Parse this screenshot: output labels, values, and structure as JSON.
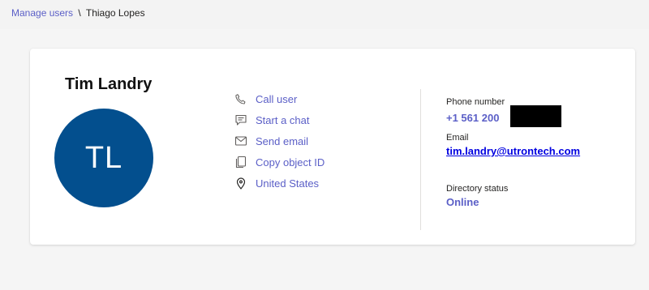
{
  "breadcrumb": {
    "parent": "Manage users",
    "separator": "\\",
    "current": "Thiago Lopes"
  },
  "profile": {
    "name": "Tim Landry",
    "initials": "TL",
    "avatar_color": "#034f8e"
  },
  "actions": [
    {
      "label": "Call user",
      "icon": "phone-icon"
    },
    {
      "label": "Start a chat",
      "icon": "chat-icon"
    },
    {
      "label": "Send email",
      "icon": "mail-icon"
    },
    {
      "label": "Copy object ID",
      "icon": "copy-icon"
    },
    {
      "label": "United States",
      "icon": "location-icon"
    }
  ],
  "details": {
    "phone_label": "Phone number",
    "phone_value": "+1 561 200",
    "email_label": "Email",
    "email_value": "tim.landry@utrontech.com",
    "status_label": "Directory status",
    "status_value": "Online"
  },
  "colors": {
    "accent": "#5b5fc7",
    "link": "#0000e0"
  }
}
